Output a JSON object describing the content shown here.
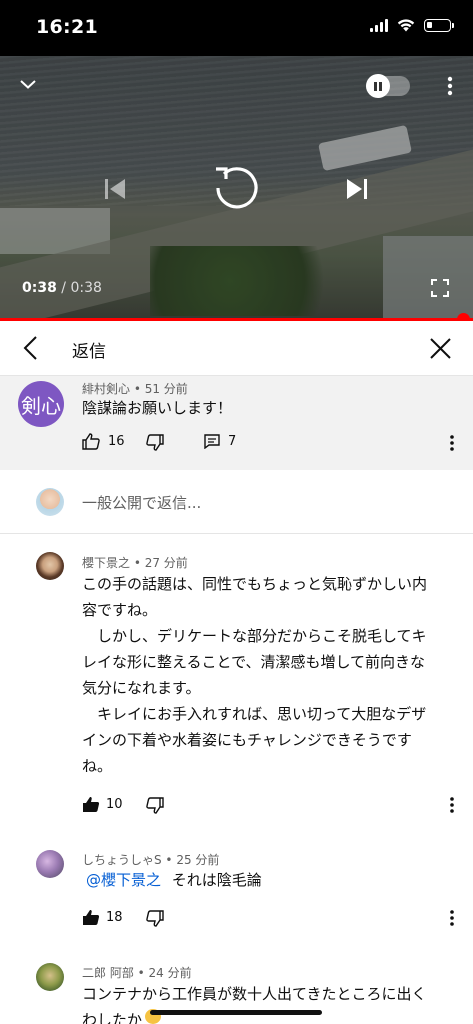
{
  "status_bar": {
    "time": "16:21"
  },
  "video": {
    "current_time": "0:38",
    "separator": "/",
    "duration": "0:38",
    "progress_fraction": 1.0
  },
  "header": {
    "title": "返信"
  },
  "parent_comment": {
    "avatar_text": "剣心",
    "avatar_color": "#7e57c2",
    "author_meta": "緋村剣心 • 51 分前",
    "text": "陰謀論お願いします！",
    "likes": "16",
    "replies": "7"
  },
  "composer": {
    "placeholder": "一般公開で返信..."
  },
  "replies": [
    {
      "author_meta": "櫻下景之 • 27 分前",
      "lines": [
        "この手の話題は、同性でもちょっと気恥ずかしい内",
        "容ですね。",
        "　しかし、デリケートな部分だからこそ脱毛してキ",
        "レイな形に整えることで、清潔感も増して前向きな",
        "気分になれます。",
        "　キレイにお手入れすれば、思い切って大胆なデザ",
        "インの下着や水着姿にもチャレンジできそうです",
        "ね。"
      ],
      "likes": "10"
    },
    {
      "author_meta": "しちょうしゃS • 25 分前",
      "mention": "@櫻下景之",
      "text": "それは陰毛論",
      "likes": "18"
    },
    {
      "author_meta": "二郎 阿部 • 24 分前",
      "lines": [
        "コンテナから工作員が数十人出てきたところに出く",
        "わしたか"
      ]
    }
  ],
  "colors": {
    "progress": "#ff0000",
    "mention": "#065fd4",
    "parent_bg": "#f2f2f2"
  }
}
